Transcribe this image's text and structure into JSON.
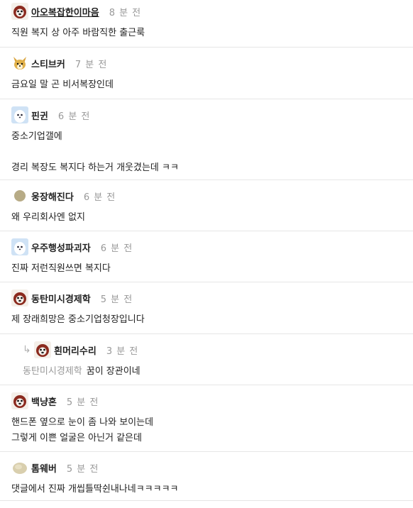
{
  "comments": [
    {
      "nick": "아오복잡한이마음",
      "time": "8 분 전",
      "lines": [
        "직원 복지 상 아주 바람직한 출근룩"
      ],
      "avatar": "dog-red-icon"
    },
    {
      "nick": "스티브커",
      "time": "7 분 전",
      "lines": [
        "금요일 말 곤 비서복장인데"
      ],
      "avatar": "fox-icon"
    },
    {
      "nick": "핀귄",
      "time": "6 분 전",
      "lines": [
        "중소기업갤에",
        "",
        "경리 복장도 복지다 하는거 개웃겼는데 ㅋㅋ"
      ],
      "avatar": "seal-icon"
    },
    {
      "nick": "웅장해진다",
      "time": "6 분 전",
      "lines": [
        "왜 우리회사엔 없지"
      ],
      "avatar": "olive-dot-icon"
    },
    {
      "nick": "우주행성파괴자",
      "time": "6 분 전",
      "lines": [
        "진짜 저런직원쓰면 복지다"
      ],
      "avatar": "seal-icon"
    },
    {
      "nick": "동탄미시경제학",
      "time": "5 분 전",
      "lines": [
        "제 장래희망은 중소기업청장입니다"
      ],
      "avatar": "dog-red-icon"
    }
  ],
  "reply": {
    "nick": "흰머리수리",
    "time": "3 분 전",
    "mention": "동탄미시경제학",
    "text": "꿈이 장관이네",
    "avatar": "dog-red-icon"
  },
  "comments2": [
    {
      "nick": "백냥혼",
      "time": "5 분 전",
      "lines": [
        "핸드폰 옆으로 눈이 좀 나와 보이는데",
        "그렇게 이쁜 얼굴은 아닌거 같은데"
      ],
      "avatar": "dog-red-icon"
    },
    {
      "nick": "톰웨버",
      "time": "5 분 전",
      "lines": [
        "댓글에서 진짜 개씹틀딱쉰내나네ㅋㅋㅋㅋㅋ"
      ],
      "avatar": "beige-blob-icon"
    }
  ],
  "colors": {
    "time": "#999999",
    "divider": "#e6e6e6",
    "text": "#222222"
  }
}
